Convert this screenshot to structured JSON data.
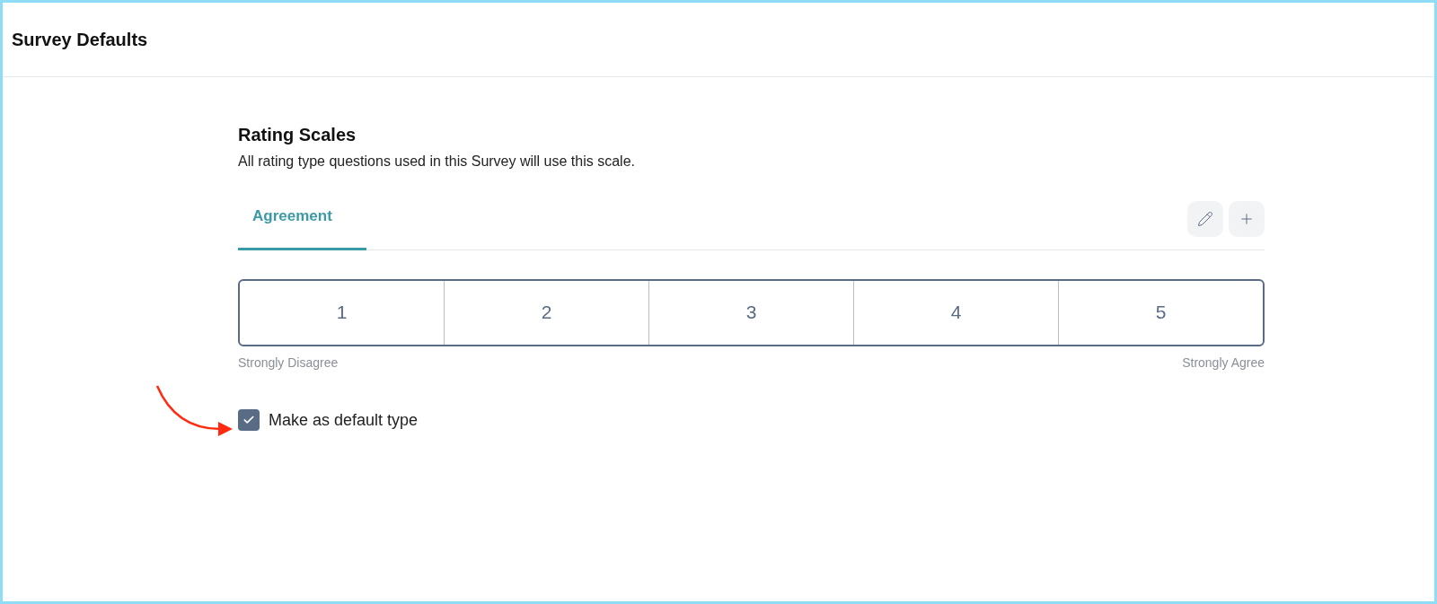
{
  "header": {
    "title": "Survey Defaults"
  },
  "section": {
    "title": "Rating Scales",
    "description": "All rating type questions used in this Survey will use this scale."
  },
  "tabs": [
    {
      "label": "Agreement",
      "selected": true
    }
  ],
  "scale": {
    "options": [
      "1",
      "2",
      "3",
      "4",
      "5"
    ],
    "min_label": "Strongly Disagree",
    "max_label": "Strongly Agree"
  },
  "default_checkbox": {
    "label": "Make as default type",
    "checked": true
  }
}
